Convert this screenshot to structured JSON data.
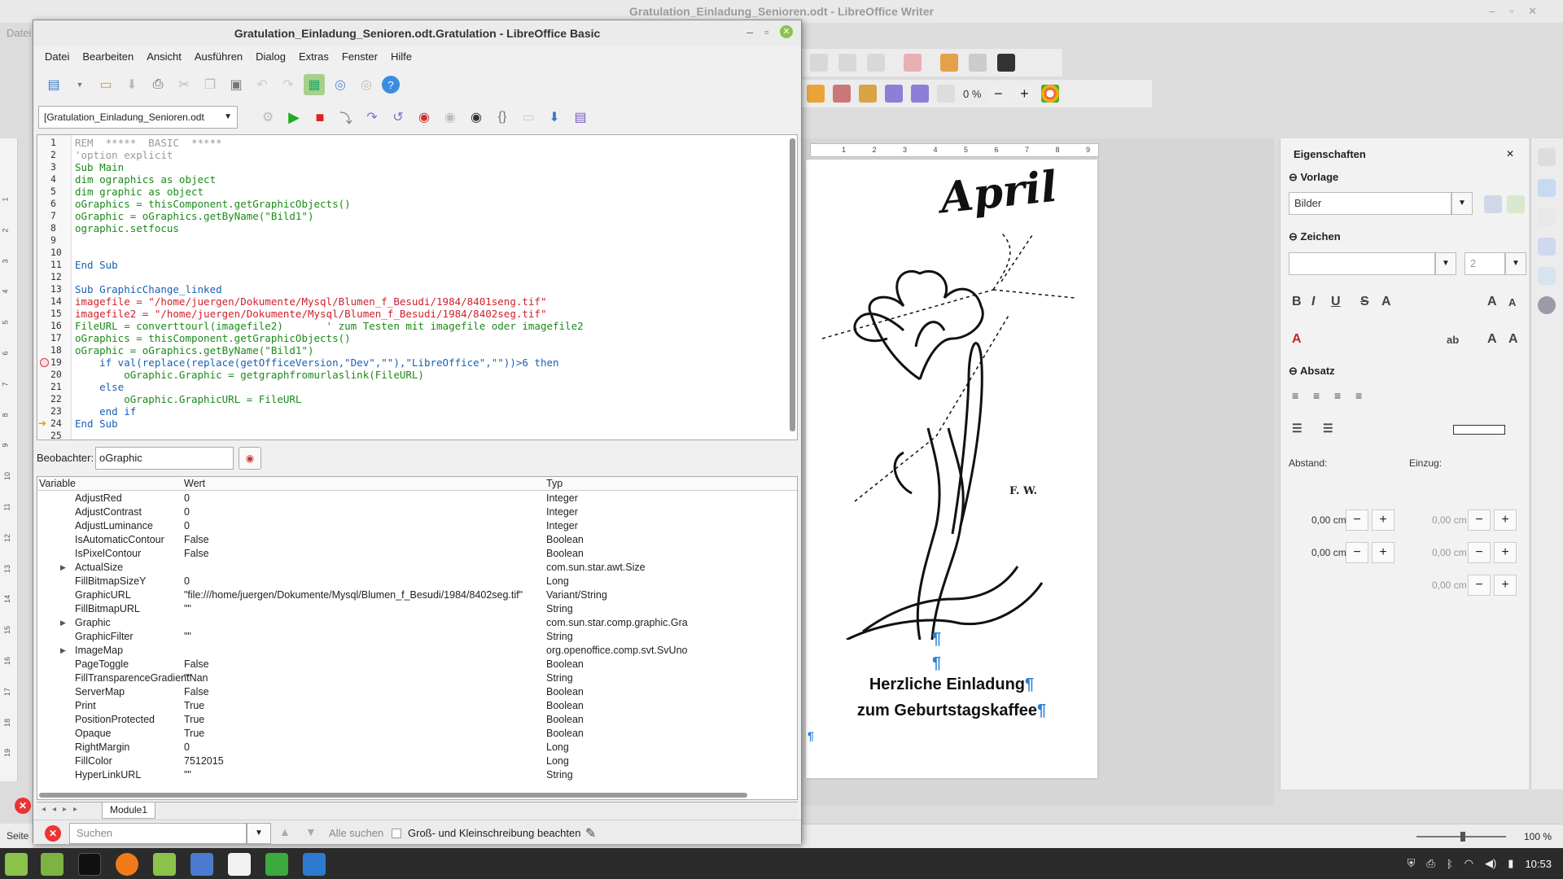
{
  "background_window": {
    "title": "Gratulation_Einladung_Senioren.odt - LibreOffice Writer",
    "menu_first": "Datei",
    "status_left": "Seite",
    "zoom_percent": "100 %",
    "image_transparency": "0 %"
  },
  "document": {
    "heading": "April",
    "line1": "Herzliche Einladung",
    "line2": "zum Geburtstagskaffee",
    "pilcrow": "¶",
    "signature": "F. W."
  },
  "ruler_top": [
    "1",
    "2",
    "3",
    "4",
    "5",
    "6",
    "7",
    "8",
    "9"
  ],
  "ruler_left": [
    "1",
    "2",
    "3",
    "4",
    "5",
    "6",
    "7",
    "8",
    "9",
    "10",
    "11",
    "12",
    "13",
    "14",
    "15",
    "16",
    "17",
    "18",
    "19"
  ],
  "sidebar": {
    "title": "Eigenschaften",
    "section_vorlage": "Vorlage",
    "vorlage_value": "Bilder",
    "section_zeichen": "Zeichen",
    "font_size": "2",
    "section_absatz": "Absatz",
    "abstand_label": "Abstand:",
    "einzug_label": "Einzug:",
    "spacing_above": "0,00 cm",
    "spacing_below": "0,00 cm",
    "indent_before": "0,00 cm",
    "indent_after": "0,00 cm",
    "indent_first": "0,00 cm"
  },
  "basic_ide": {
    "title": "Gratulation_Einladung_Senioren.odt.Gratulation - LibreOffice Basic",
    "menu": [
      "Datei",
      "Bearbeiten",
      "Ansicht",
      "Ausführen",
      "Dialog",
      "Extras",
      "Fenster",
      "Hilfe"
    ],
    "library_select": "[Gratulation_Einladung_Senioren.odt",
    "code_lines": [
      {
        "n": "1",
        "text": "REM  *****  BASIC  *****",
        "color": "#999999"
      },
      {
        "n": "2",
        "text": "'option explicit",
        "color": "#999999"
      },
      {
        "n": "3",
        "text": "Sub Main",
        "color": "#1a8a1a"
      },
      {
        "n": "4",
        "text": "dim ographics as object",
        "color": "#1a8a1a"
      },
      {
        "n": "5",
        "text": "dim graphic as object",
        "color": "#1a8a1a"
      },
      {
        "n": "6",
        "text": "oGraphics = thisComponent.getGraphicObjects()",
        "color": "#1a8a1a"
      },
      {
        "n": "7",
        "text": "oGraphic = oGraphics.getByName(\"Bild1\")",
        "color": "#1a8a1a"
      },
      {
        "n": "8",
        "text": "ographic.setfocus",
        "color": "#1a8a1a"
      },
      {
        "n": "9",
        "text": "",
        "color": "#1a8a1a"
      },
      {
        "n": "10",
        "text": "",
        "color": "#1a8a1a"
      },
      {
        "n": "11",
        "text": "End Sub",
        "color": "#1a5fb4"
      },
      {
        "n": "12",
        "text": "",
        "color": "#1a8a1a"
      },
      {
        "n": "13",
        "text": "Sub GraphicChange_linked",
        "color": "#1a5fb4"
      },
      {
        "n": "14",
        "text": "imagefile = \"/home/juergen/Dokumente/Mysql/Blumen_f_Besudi/1984/8401seng.tif\"",
        "color": "#d0202c"
      },
      {
        "n": "15",
        "text": "imagefile2 = \"/home/juergen/Dokumente/Mysql/Blumen_f_Besudi/1984/8402seg.tif\"",
        "color": "#d0202c"
      },
      {
        "n": "16",
        "text": "FileURL = converttourl(imagefile2)       ' zum Testen mit imagefile oder imagefile2",
        "color": "#1a8a1a"
      },
      {
        "n": "17",
        "text": "oGraphics = thisComponent.getGraphicObjects()",
        "color": "#1a8a1a"
      },
      {
        "n": "18",
        "text": "oGraphic = oGraphics.getByName(\"Bild1\")",
        "color": "#1a8a1a"
      },
      {
        "n": "19",
        "text": "    if val(replace(replace(getOfficeVersion,\"Dev\",\"\"),\"LibreOffice\",\"\"))>6 then",
        "color": "#1a5fb4"
      },
      {
        "n": "20",
        "text": "        oGraphic.Graphic = getgraphfromurlaslink(FileURL)",
        "color": "#1a8a1a"
      },
      {
        "n": "21",
        "text": "    else",
        "color": "#1a5fb4"
      },
      {
        "n": "22",
        "text": "        oGraphic.GraphicURL = FileURL",
        "color": "#1a8a1a"
      },
      {
        "n": "23",
        "text": "    end if",
        "color": "#1a5fb4"
      },
      {
        "n": "24",
        "text": "End Sub",
        "color": "#1a5fb4"
      },
      {
        "n": "25",
        "text": "",
        "color": "#1a8a1a"
      }
    ],
    "breakpoint_line": "19",
    "current_line": "24",
    "watch_label": "Beobachter:",
    "watch_value": "oGraphic",
    "watch_columns": [
      "Variable",
      "Wert",
      "Typ"
    ],
    "watch_rows": [
      {
        "name": "AdjustRed",
        "value": "0",
        "type": "Integer",
        "expandable": false
      },
      {
        "name": "AdjustContrast",
        "value": "0",
        "type": "Integer",
        "expandable": false
      },
      {
        "name": "AdjustLuminance",
        "value": "0",
        "type": "Integer",
        "expandable": false
      },
      {
        "name": "IsAutomaticContour",
        "value": "False",
        "type": "Boolean",
        "expandable": false
      },
      {
        "name": "IsPixelContour",
        "value": "False",
        "type": "Boolean",
        "expandable": false
      },
      {
        "name": "ActualSize",
        "value": "",
        "type": "com.sun.star.awt.Size",
        "expandable": true
      },
      {
        "name": "FillBitmapSizeY",
        "value": "0",
        "type": "Long",
        "expandable": false
      },
      {
        "name": "GraphicURL",
        "value": "\"file:///home/juergen/Dokumente/Mysql/Blumen_f_Besudi/1984/8402seg.tif\"",
        "type": "Variant/String",
        "expandable": false
      },
      {
        "name": "FillBitmapURL",
        "value": "\"\"",
        "type": "String",
        "expandable": false
      },
      {
        "name": "Graphic",
        "value": "",
        "type": "com.sun.star.comp.graphic.Gra",
        "expandable": true
      },
      {
        "name": "GraphicFilter",
        "value": "\"\"",
        "type": "String",
        "expandable": false
      },
      {
        "name": "ImageMap",
        "value": "",
        "type": "org.openoffice.comp.svt.SvUno",
        "expandable": true
      },
      {
        "name": "PageToggle",
        "value": "False",
        "type": "Boolean",
        "expandable": false
      },
      {
        "name": "FillTransparenceGradientNan",
        "value": "\"\"",
        "type": "String",
        "expandable": false
      },
      {
        "name": "ServerMap",
        "value": "False",
        "type": "Boolean",
        "expandable": false
      },
      {
        "name": "Print",
        "value": "True",
        "type": "Boolean",
        "expandable": false
      },
      {
        "name": "PositionProtected",
        "value": "True",
        "type": "Boolean",
        "expandable": false
      },
      {
        "name": "Opaque",
        "value": "True",
        "type": "Boolean",
        "expandable": false
      },
      {
        "name": "RightMargin",
        "value": "0",
        "type": "Long",
        "expandable": false
      },
      {
        "name": "FillColor",
        "value": "7512015",
        "type": "Long",
        "expandable": false
      },
      {
        "name": "HyperLinkURL",
        "value": "\"\"",
        "type": "String",
        "expandable": false
      }
    ],
    "module_tab": "Module1",
    "find": {
      "placeholder": "Suchen",
      "find_all": "Alle suchen",
      "match_case": "Groß- und Kleinschreibung beachten"
    }
  },
  "taskbar": {
    "clock": "10:53"
  }
}
